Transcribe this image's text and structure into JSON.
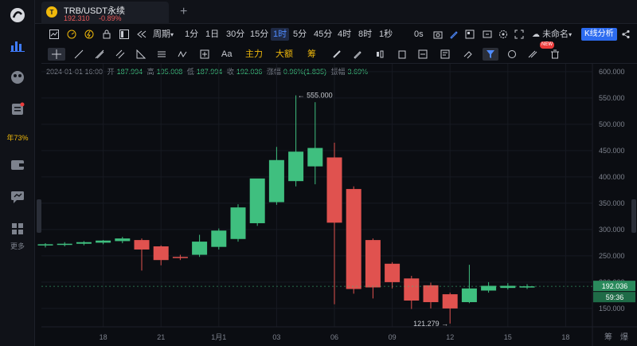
{
  "sidebar": {
    "promo_label": "年73%",
    "more_label": "更多"
  },
  "tab": {
    "title": "TRB/USDT永续",
    "price": "192.310",
    "change": "-0.89%",
    "coin_glyph": "T"
  },
  "toolbar1": {
    "period_label": "周期",
    "intervals": [
      "1分",
      "1日",
      "30分",
      "15分",
      "1时",
      "5分",
      "45分",
      "4时",
      "8时",
      "1秒"
    ],
    "selected_interval": "1时",
    "countdown_label": "0s",
    "unnamed_label": "未命名",
    "kline_button": "K线分析"
  },
  "toolbar2": {
    "main_force": "主力",
    "large_order": "大额",
    "chips": "筹",
    "aa": "Aa",
    "new_badge": "NEW"
  },
  "ohlc": {
    "date": "2024-01-01 16:00",
    "open_label": "开",
    "open": "187.994",
    "high_label": "高",
    "high": "195.008",
    "low_label": "低",
    "low": "187.994",
    "close_label": "收",
    "close": "192.036",
    "change_label": "涨幅",
    "change": "0.96%(1.835)",
    "amp_label": "振幅",
    "amp": "3.69%"
  },
  "chart_data": {
    "type": "candlestick",
    "ylim": [
      115,
      615
    ],
    "y_ticks": [
      "600.000",
      "550.000",
      "500.000",
      "450.000",
      "400.000",
      "350.000",
      "300.000",
      "250.000",
      "200.000",
      "150.000"
    ],
    "y_tick_values": [
      600,
      550,
      500,
      450,
      400,
      350,
      300,
      250,
      200,
      150
    ],
    "x_ticks": [
      "18",
      "21",
      "1月1",
      "03",
      "06",
      "09",
      "12",
      "15",
      "18"
    ],
    "x_tick_index": [
      3,
      6,
      9,
      12,
      15,
      18,
      21,
      24,
      27
    ],
    "candles": [
      {
        "o": 270,
        "h": 274,
        "l": 266,
        "c": 272
      },
      {
        "o": 272,
        "h": 276,
        "l": 268,
        "c": 273
      },
      {
        "o": 273,
        "h": 278,
        "l": 270,
        "c": 276
      },
      {
        "o": 275,
        "h": 280,
        "l": 272,
        "c": 279
      },
      {
        "o": 278,
        "h": 286,
        "l": 274,
        "c": 283
      },
      {
        "o": 280,
        "h": 283,
        "l": 222,
        "c": 262
      },
      {
        "o": 268,
        "h": 270,
        "l": 232,
        "c": 242
      },
      {
        "o": 248,
        "h": 252,
        "l": 242,
        "c": 247
      },
      {
        "o": 252,
        "h": 290,
        "l": 248,
        "c": 277
      },
      {
        "o": 267,
        "h": 302,
        "l": 262,
        "c": 298
      },
      {
        "o": 282,
        "h": 348,
        "l": 277,
        "c": 342
      },
      {
        "o": 312,
        "h": 372,
        "l": 307,
        "c": 397
      },
      {
        "o": 352,
        "h": 457,
        "l": 347,
        "c": 432
      },
      {
        "o": 392,
        "h": 555,
        "l": 382,
        "c": 448
      },
      {
        "o": 420,
        "h": 542,
        "l": 386,
        "c": 455
      },
      {
        "o": 437,
        "h": 465,
        "l": 158,
        "c": 313
      },
      {
        "o": 377,
        "h": 382,
        "l": 178,
        "c": 187
      },
      {
        "o": 280,
        "h": 283,
        "l": 169,
        "c": 190
      },
      {
        "o": 235,
        "h": 238,
        "l": 188,
        "c": 200
      },
      {
        "o": 207,
        "h": 212,
        "l": 149,
        "c": 165
      },
      {
        "o": 194,
        "h": 199,
        "l": 150,
        "c": 162
      },
      {
        "o": 177,
        "h": 180,
        "l": 121.279,
        "c": 150
      },
      {
        "o": 162,
        "h": 233,
        "l": 160,
        "c": 188
      },
      {
        "o": 184,
        "h": 200,
        "l": 180,
        "c": 193
      },
      {
        "o": 189,
        "h": 198,
        "l": 186,
        "c": 193
      },
      {
        "o": 190,
        "h": 196,
        "l": 187,
        "c": 192.036
      }
    ],
    "high_annotation": "555.000",
    "low_annotation": "121.279",
    "last_price_label": "192.036",
    "countdown_label": "59:36",
    "corner_labels": [
      "筹",
      "爆"
    ],
    "colors": {
      "up": "#3fbf7f",
      "down": "#e0524f",
      "bg": "#0b0d12",
      "grid": "#171a22"
    }
  }
}
